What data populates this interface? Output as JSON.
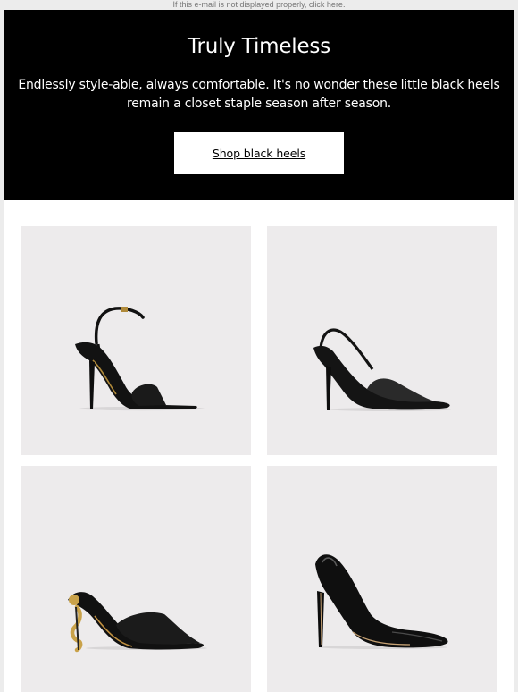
{
  "preheader": {
    "text": "If this e-mail is not displayed properly, click here."
  },
  "hero": {
    "title": "Truly Timeless",
    "body": "Endlessly style-able, always comfortable. It's no wonder these little black heels remain a closet staple season after season.",
    "cta_label": "Shop black heels"
  },
  "products": [
    {
      "icon": "ankle-strap-sandal-heel-icon"
    },
    {
      "icon": "slingback-pump-heel-icon"
    },
    {
      "icon": "mule-sandal-snake-heel-icon"
    },
    {
      "icon": "patent-pump-heel-icon"
    }
  ],
  "colors": {
    "hero_bg": "#000000",
    "tile_bg": "#edebec",
    "cta_bg": "#ffffff"
  }
}
